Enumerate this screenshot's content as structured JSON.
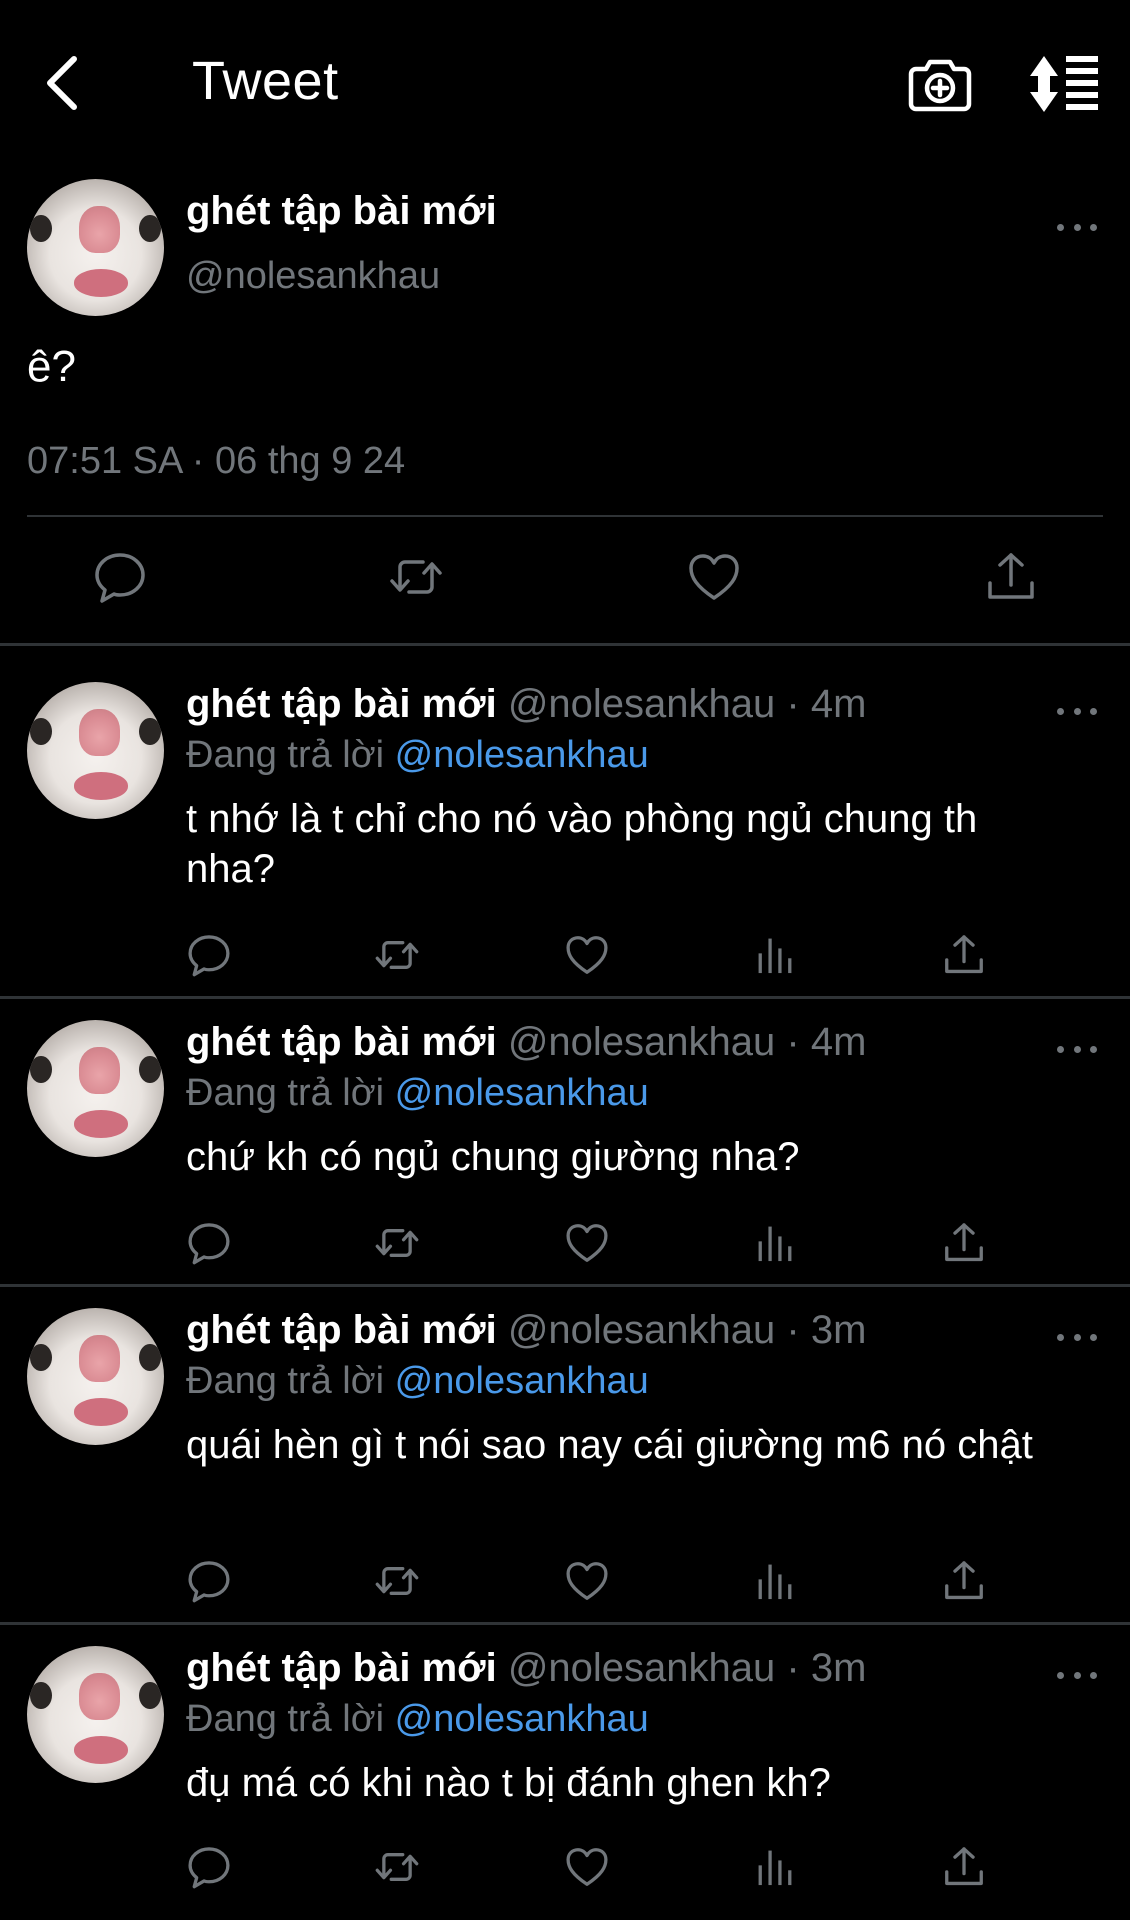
{
  "header": {
    "title": "Tweet",
    "back_icon": "chevron-left-icon",
    "camera_icon": "camera-plus-icon",
    "sort_icon": "sort-list-icon"
  },
  "main_tweet": {
    "name": "ghét tập bài mới",
    "handle": "@nolesankhau",
    "text": "ê?",
    "timestamp": "07:51 SA · 06 thg 9 24"
  },
  "replies": [
    {
      "name": "ghét tập bài mới",
      "meta": "@nolesankhau · 4m",
      "reply_prefix": "Đang trả lời",
      "reply_mention": "@nolesankhau",
      "text": "t nhớ là t chỉ cho nó vào phòng ngủ chung th nha?"
    },
    {
      "name": "ghét tập bài mới",
      "meta": "@nolesankhau · 4m",
      "reply_prefix": "Đang trả lời",
      "reply_mention": "@nolesankhau",
      "text": "chứ kh có ngủ chung giường nha?"
    },
    {
      "name": "ghét tập bài mới",
      "meta": "@nolesankhau · 3m",
      "reply_prefix": "Đang trả lời",
      "reply_mention": "@nolesankhau",
      "text": "quái hèn gì t nói sao nay cái giường m6 nó chật"
    },
    {
      "name": "ghét tập bài mới",
      "meta": "@nolesankhau · 3m",
      "reply_prefix": "Đang trả lời",
      "reply_mention": "@nolesankhau",
      "text": "đụ má có khi nào t bị đánh ghen kh?"
    }
  ],
  "colors": {
    "background": "#000000",
    "secondary_text": "#71767b",
    "mention": "#4a99e9",
    "divider": "#2f3336"
  }
}
